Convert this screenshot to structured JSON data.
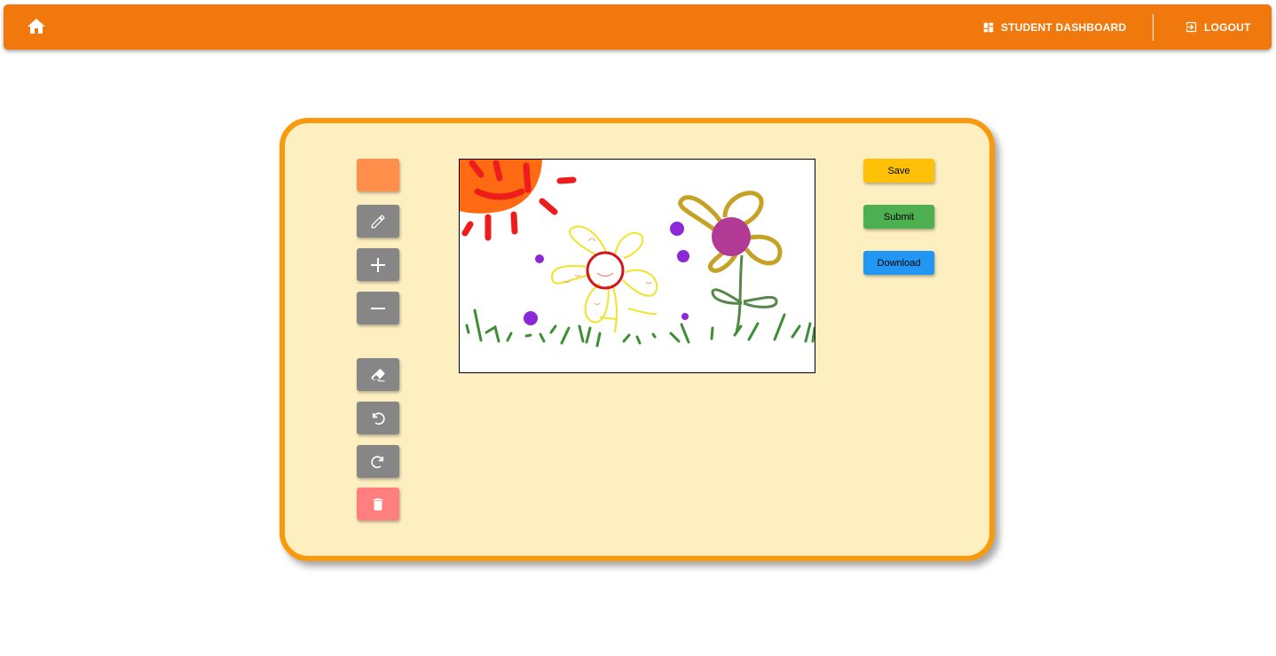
{
  "nav": {
    "home_icon": "home-icon",
    "dashboard_label": "STUDENT DASHBOARD",
    "dashboard_icon": "dashboard-icon",
    "logout_label": "LOGOUT",
    "logout_icon": "logout-icon"
  },
  "toolbar": {
    "current_color": "#ff8f4a",
    "tools": [
      "color-swatch",
      "pencil-icon",
      "plus-icon",
      "minus-icon",
      "eraser-icon",
      "undo-icon",
      "redo-icon",
      "trash-icon"
    ]
  },
  "actions": {
    "save_label": "Save",
    "submit_label": "Submit",
    "download_label": "Download"
  },
  "colors": {
    "topbar": "#f0780d",
    "board_fill": "#feefc1",
    "board_border": "#f89a0c",
    "tool_gray": "#868686",
    "delete_red": "#ff7e7e",
    "save": "#ffc107",
    "submit": "#4caf50",
    "download": "#2196f3"
  }
}
